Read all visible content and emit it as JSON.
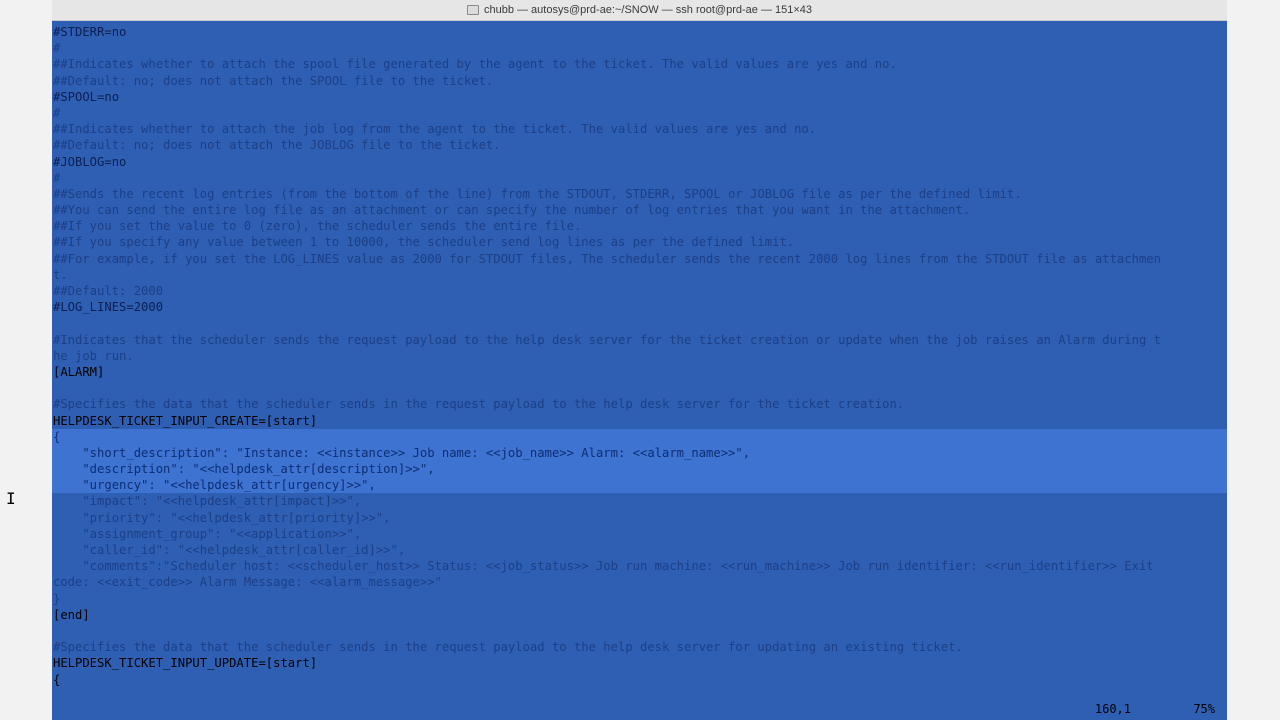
{
  "window": {
    "title": "chubb — autosys@prd-ae:~/SNOW — ssh root@prd-ae — 151×43"
  },
  "lines": [
    {
      "text": "#STDERR=no",
      "style": "hl"
    },
    {
      "text": "#",
      "style": ""
    },
    {
      "text": "##Indicates whether to attach the spool file generated by the agent to the ticket. The valid values are yes and no.",
      "style": ""
    },
    {
      "text": "##Default: no; does not attach the SPOOL file to the ticket.",
      "style": ""
    },
    {
      "text": "#SPOOL=no",
      "style": "hl"
    },
    {
      "text": "#",
      "style": ""
    },
    {
      "text": "##Indicates whether to attach the job log from the agent to the ticket. The valid values are yes and no.",
      "style": ""
    },
    {
      "text": "##Default: no; does not attach the JOBLOG file to the ticket.",
      "style": ""
    },
    {
      "text": "#JOBLOG=no",
      "style": "hl"
    },
    {
      "text": "#",
      "style": ""
    },
    {
      "text": "##Sends the recent log entries (from the bottom of the line) from the STDOUT, STDERR, SPOOL or JOBLOG file as per the defined limit.",
      "style": ""
    },
    {
      "text": "##You can send the entire log file as an attachment or can specify the number of log entries that you want in the attachment.",
      "style": ""
    },
    {
      "text": "##If you set the value to 0 (zero), the scheduler sends the entire file.",
      "style": ""
    },
    {
      "text": "##If you specify any value between 1 to 10000, the scheduler send log lines as per the defined limit.",
      "style": ""
    },
    {
      "text": "##For example, if you set the LOG_LINES value as 2000 for STDOUT files, The scheduler sends the recent 2000 log lines from the STDOUT file as attachmen",
      "style": ""
    },
    {
      "text": "t.",
      "style": ""
    },
    {
      "text": "##Default: 2000",
      "style": ""
    },
    {
      "text": "#LOG_LINES=2000",
      "style": "hl"
    },
    {
      "text": "",
      "style": ""
    },
    {
      "text": "#Indicates that the scheduler sends the request payload to the help desk server for the ticket creation or update when the job raises an Alarm during t",
      "style": ""
    },
    {
      "text": "he job run.",
      "style": ""
    },
    {
      "text": "[ALARM]",
      "style": "code"
    },
    {
      "text": "",
      "style": ""
    },
    {
      "text": "#Specifies the data that the scheduler sends in the request payload to the help desk server for the ticket creation.",
      "style": ""
    },
    {
      "text": "HELPDESK_TICKET_INPUT_CREATE=[start]",
      "style": "code"
    },
    {
      "text": "{",
      "style": "sel code"
    },
    {
      "text": "    \"short_description\": \"Instance: <<instance>> Job name: <<job_name>> Alarm: <<alarm_name>>\",",
      "style": "sel"
    },
    {
      "text": "    \"description\": \"<<helpdesk_attr[description]>>\",",
      "style": "sel"
    },
    {
      "text": "    \"urgency\": \"<<helpdesk_attr[urgency]>>\",",
      "style": "sel"
    },
    {
      "text": "    \"impact\": \"<<helpdesk_attr[impact]>>\",",
      "style": ""
    },
    {
      "text": "    \"priority\": \"<<helpdesk_attr[priority]>>\",",
      "style": ""
    },
    {
      "text": "    \"assignment_group\": \"<<application>>\",",
      "style": ""
    },
    {
      "text": "    \"caller_id\": \"<<helpdesk_attr[caller_id]>>\",",
      "style": ""
    },
    {
      "text": "    \"comments\":\"Scheduler host: <<scheduler_host>> Status: <<job_status>> Job run machine: <<run_machine>> Job run identifier: <<run_identifier>> Exit",
      "style": ""
    },
    {
      "text": "code: <<exit_code>> Alarm Message: <<alarm_message>>\"",
      "style": ""
    },
    {
      "text": "}",
      "style": ""
    },
    {
      "text": "[end]",
      "style": "code"
    },
    {
      "text": "",
      "style": ""
    },
    {
      "text": "#Specifies the data that the scheduler sends in the request payload to the help desk server for updating an existing ticket.",
      "style": ""
    },
    {
      "text": "HELPDESK_TICKET_INPUT_UPDATE=[start]",
      "style": "code"
    },
    {
      "text": "{",
      "style": "code"
    },
    {
      "text": "",
      "style": ""
    }
  ],
  "status": {
    "position": "160,1",
    "percent": "75%"
  },
  "colors": {
    "terminal_bg": "#2f5fb3",
    "selection": "#3e73d1",
    "comment": "#1c3f86"
  }
}
